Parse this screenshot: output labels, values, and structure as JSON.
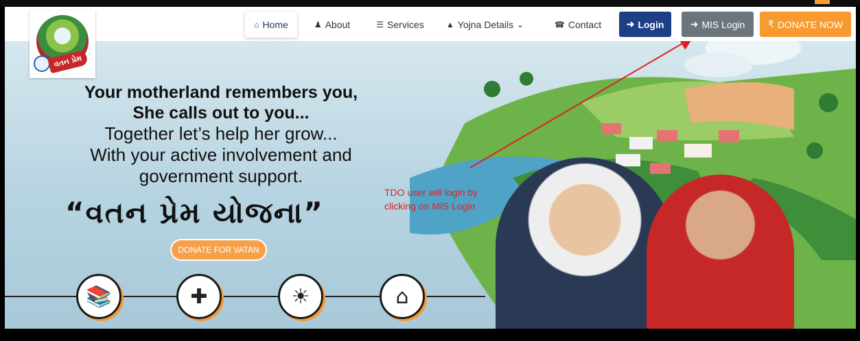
{
  "nav": {
    "home": "Home",
    "about": "About",
    "services": "Services",
    "yojna_details": "Yojna Details",
    "contact": "Contact",
    "login": "Login",
    "mis_login": "MIS Login",
    "donate": "DONATE NOW"
  },
  "logo": {
    "ribbon_text": "વતન પ્રેમ"
  },
  "hero": {
    "line1": "Your motherland remembers you,",
    "line2": "She calls out to you...",
    "line3": "Together let’s help her grow...",
    "line4": "With your active involvement and",
    "line5": "government support.",
    "yojna": "“વતન પ્રેમ યોજના”",
    "donate_button": "DONATE FOR VATAN"
  },
  "annotation": {
    "line1": "TDO user will login by",
    "line2": "clicking on MIS Login"
  },
  "icons": [
    "books-icon",
    "medical-cross-icon",
    "solar-panel-icon",
    "gate-icon"
  ],
  "colors": {
    "login_bg": "#1c3f86",
    "mis_bg": "#6c757d",
    "donate_bg": "#f79a2f",
    "annotation": "#e02020"
  }
}
